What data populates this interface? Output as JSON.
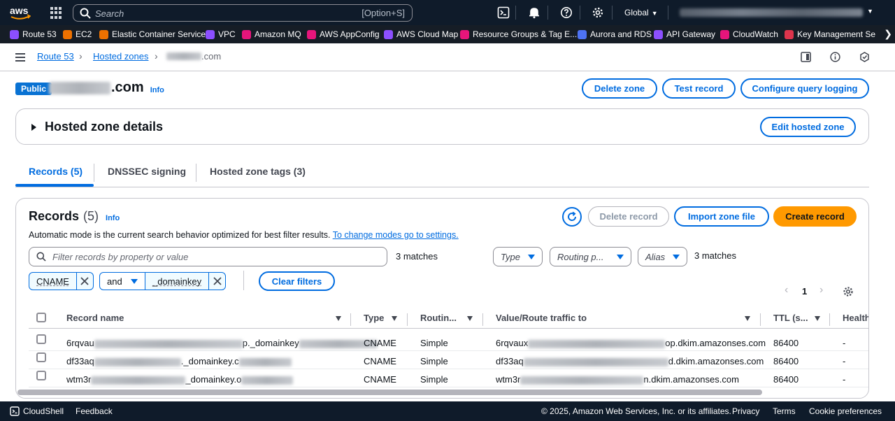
{
  "topnav": {
    "logo": "aws",
    "search_placeholder": "Search",
    "search_shortcut": "[Option+S]",
    "region": "Global",
    "icons": [
      "services-grid-icon",
      "cloudshell-icon",
      "bell-icon",
      "help-icon",
      "gear-icon"
    ]
  },
  "favorites": [
    {
      "label": "Route 53",
      "color": "#8c4fff"
    },
    {
      "label": "EC2",
      "color": "#ed7100"
    },
    {
      "label": "Elastic Container Service",
      "color": "#ed7100"
    },
    {
      "label": "VPC",
      "color": "#8c4fff"
    },
    {
      "label": "Amazon MQ",
      "color": "#e7157b"
    },
    {
      "label": "AWS AppConfig",
      "color": "#e7157b"
    },
    {
      "label": "AWS Cloud Map",
      "color": "#8c4fff"
    },
    {
      "label": "Resource Groups & Tag E...",
      "color": "#e7157b"
    },
    {
      "label": "Aurora and RDS",
      "color": "#4d72f3"
    },
    {
      "label": "API Gateway",
      "color": "#8c4fff"
    },
    {
      "label": "CloudWatch",
      "color": "#e7157b"
    },
    {
      "label": "Key Management Se",
      "color": "#dd344c"
    }
  ],
  "breadcrumb": {
    "items": [
      "Route 53",
      "Hosted zones"
    ],
    "current_suffix": ".com"
  },
  "header": {
    "badge": "Public",
    "title_suffix": ".com",
    "info": "Info",
    "buttons": {
      "delete_zone": "Delete zone",
      "test_record": "Test record",
      "configure_logging": "Configure query logging"
    }
  },
  "details": {
    "title": "Hosted zone details",
    "edit_button": "Edit hosted zone"
  },
  "tabs": [
    {
      "label": "Records (5)",
      "active": true
    },
    {
      "label": "DNSSEC signing",
      "active": false
    },
    {
      "label": "Hosted zone tags (3)",
      "active": false
    }
  ],
  "records": {
    "title": "Records",
    "count": "(5)",
    "info": "Info",
    "mode_text": "Automatic mode is the current search behavior optimized for best filter results.",
    "mode_link": "To change modes go to settings.",
    "buttons": {
      "delete": "Delete record",
      "import": "Import zone file",
      "create": "Create record"
    },
    "filter_placeholder": "Filter records by property or value",
    "matches_left": "3 matches",
    "matches_right": "3 matches",
    "selects": {
      "type": "Type",
      "routing": "Routing p...",
      "alias": "Alias"
    },
    "tokens": {
      "first": "CNAME",
      "operator": "and",
      "second": "_domainkey"
    },
    "clear_filters": "Clear filters",
    "page": "1",
    "columns": [
      "Record name",
      "Type",
      "Routin...",
      "Value/Route traffic to",
      "TTL (s...",
      "Health"
    ],
    "rows": [
      {
        "name_prefix": "6rqvau",
        "name_mid": "p._domainkey",
        "type": "CNAME",
        "routing": "Simple",
        "value_prefix": "6rqvaux",
        "value_suffix": "op.dkim.amazonses.com",
        "ttl": "86400",
        "health": "-"
      },
      {
        "name_prefix": "df33aq",
        "name_mid": "._domainkey.c",
        "type": "CNAME",
        "routing": "Simple",
        "value_prefix": "df33aq",
        "value_suffix": "d.dkim.amazonses.com",
        "ttl": "86400",
        "health": "-"
      },
      {
        "name_prefix": "wtm3r",
        "name_mid": "_domainkey.o",
        "type": "CNAME",
        "routing": "Simple",
        "value_prefix": "wtm3r",
        "value_suffix": "n.dkim.amazonses.com",
        "ttl": "86400",
        "health": "-"
      }
    ]
  },
  "footer": {
    "cloudshell": "CloudShell",
    "feedback": "Feedback",
    "copyright": "© 2025, Amazon Web Services, Inc. or its affiliates.",
    "privacy": "Privacy",
    "terms": "Terms",
    "cookies": "Cookie preferences"
  }
}
